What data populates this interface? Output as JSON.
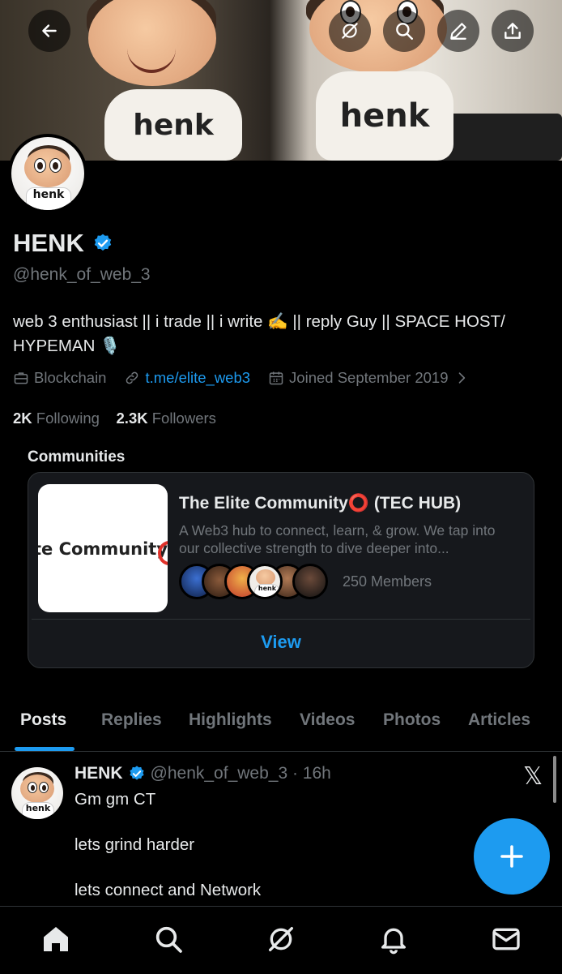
{
  "profile": {
    "name": "HENK",
    "handle": "@henk_of_web_3",
    "bio": "web 3 enthusiast || i trade || i write ✍️ || reply Guy || SPACE HOST/ HYPEMAN 🎙️",
    "category": "Blockchain",
    "link": "t.me/elite_web3",
    "joined": "Joined September 2019",
    "following_count": "2K",
    "following_label": "Following",
    "followers_count": "2.3K",
    "followers_label": "Followers",
    "banner_text_left": "henk",
    "banner_text_right": "henk",
    "avatar_text": "henk"
  },
  "communities": {
    "label": "Communities",
    "card": {
      "image_text": "te Community",
      "title": "The Elite Community⭕ (TEC HUB)",
      "description": "A Web3 hub to connect, learn, & grow. We tap into our collective strength to dive deeper into...",
      "members": "250 Members",
      "view_label": "View",
      "member_avatar_text": "henk"
    }
  },
  "tabs": [
    "Posts",
    "Replies",
    "Highlights",
    "Videos",
    "Photos",
    "Articles"
  ],
  "active_tab": "Posts",
  "post": {
    "author": "HENK",
    "meta": "@henk_of_web_3 · 16h",
    "lines": [
      "Gm gm CT",
      "lets grind harder",
      "lets connect and Network"
    ],
    "avatar_text": "henk",
    "x_logo": "𝕏"
  },
  "icons": {
    "top_bar": [
      "back-arrow-icon",
      "grok-icon",
      "search-icon",
      "edit-icon",
      "share-icon"
    ],
    "bottom_nav": [
      "home-icon",
      "search-icon",
      "grok-icon",
      "notifications-icon",
      "messages-icon"
    ],
    "fab": "plus-icon"
  },
  "colors": {
    "accent": "#1d9bf0",
    "background": "#000000",
    "text_primary": "#e7e9ea",
    "text_secondary": "#71767b",
    "border": "#2f3336",
    "card_bg": "#16181c"
  }
}
